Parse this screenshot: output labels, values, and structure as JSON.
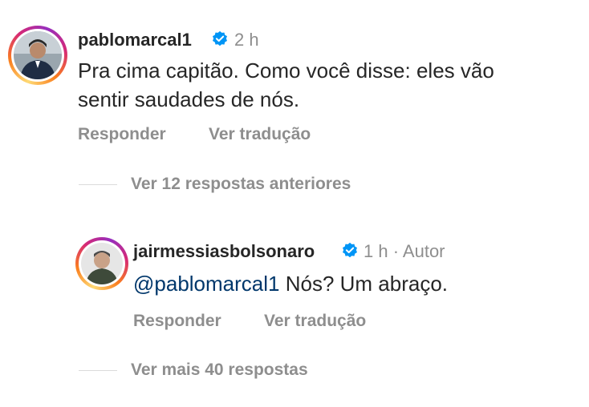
{
  "comment": {
    "username": "pablomarcal1",
    "time": "2 h",
    "text_line1": "Pra cima capitão. Como você disse: eles vão",
    "text_line2": "sentir saudades de nós.",
    "reply_label": "Responder",
    "translate_label": "Ver tradução"
  },
  "previous_replies": "Ver 12 respostas anteriores",
  "reply": {
    "username": "jairmessiasbolsonaro",
    "time": "1 h · Autor",
    "mention": "@pablomarcal1",
    "text": " Nós? Um abraço.",
    "reply_label": "Responder",
    "translate_label": "Ver tradução"
  },
  "more_replies": "Ver mais 40 respostas",
  "colors": {
    "verified": "#0095f6",
    "mention": "#00376b",
    "muted": "#8e8e8e"
  }
}
